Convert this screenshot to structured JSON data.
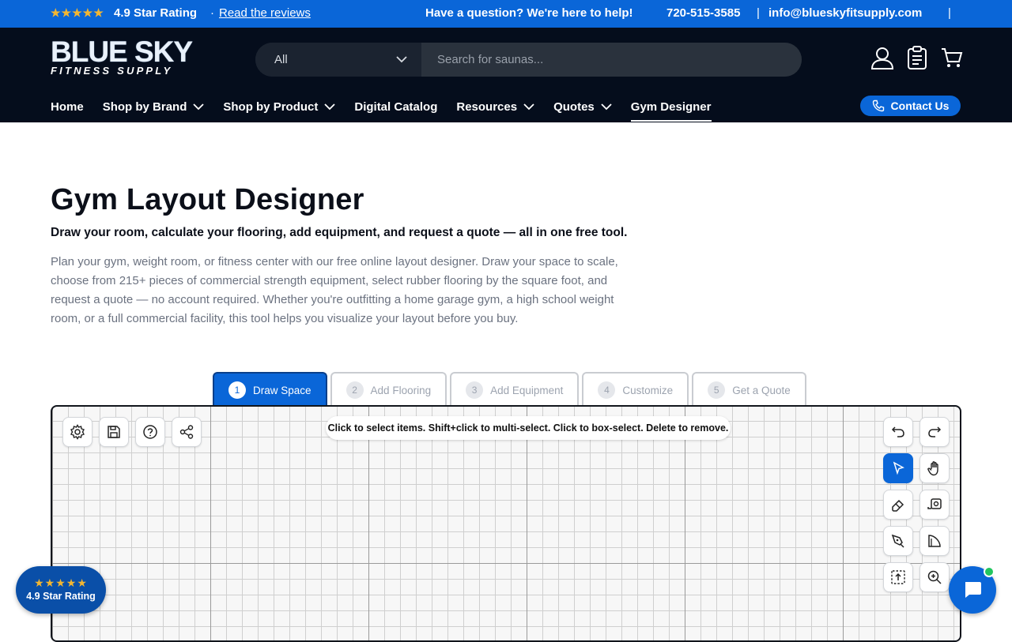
{
  "announcement": {
    "stars": "★★★★★",
    "rating": "4.9 Star Rating",
    "separator": "·",
    "reviews_link": "Read the reviews",
    "question": "Have a question? We're here to help!",
    "phone": "720-515-3585",
    "divider": "|",
    "email": "info@blueskyfitsupply.com"
  },
  "header": {
    "logo_line1": "BLUE SKY",
    "logo_line2": "FITNESS SUPPLY",
    "search": {
      "category": "All",
      "placeholder": "Search for saunas..."
    },
    "icons": [
      "account-icon",
      "clipboard-icon",
      "cart-icon"
    ]
  },
  "nav": {
    "items": [
      {
        "label": "Home",
        "dropdown": false
      },
      {
        "label": "Shop by Brand",
        "dropdown": true
      },
      {
        "label": "Shop by Product",
        "dropdown": true
      },
      {
        "label": "Digital Catalog",
        "dropdown": false
      },
      {
        "label": "Resources",
        "dropdown": true
      },
      {
        "label": "Quotes",
        "dropdown": true
      },
      {
        "label": "Gym Designer",
        "dropdown": false,
        "active": true
      }
    ],
    "contact_label": "Contact Us"
  },
  "main": {
    "title": "Gym Layout Designer",
    "subtitle": "Draw your room, calculate your flooring, add equipment, and request a quote — all in one free tool.",
    "description": "Plan your gym, weight room, or fitness center with our free online layout designer. Draw your space to scale, choose from 215+ pieces of commercial strength equipment, select rubber flooring by the square foot, and request a quote — no account required. Whether you're outfitting a home garage gym, a high school weight room, or a full commercial facility, this tool helps you visualize your layout before you buy."
  },
  "designer": {
    "steps": [
      {
        "num": "1",
        "label": "Draw Space",
        "active": true
      },
      {
        "num": "2",
        "label": "Add Flooring"
      },
      {
        "num": "3",
        "label": "Add Equipment"
      },
      {
        "num": "4",
        "label": "Customize"
      },
      {
        "num": "5",
        "label": "Get a Quote"
      }
    ],
    "hint": "Click to select items. Shift+click to multi-select. Click to box-select. Delete to remove.",
    "left_tools": [
      "settings-icon",
      "save-icon",
      "help-icon",
      "share-icon"
    ],
    "right_tools": [
      "undo-icon",
      "redo-icon",
      "select-icon",
      "pan-icon",
      "eraser-icon",
      "tape-measure-icon",
      "pen-icon",
      "wall-corner-icon",
      "fit-view-icon",
      "zoom-in-icon"
    ],
    "selected_tool": "select-icon"
  },
  "floating": {
    "badge_stars": "★★★★★",
    "badge_text": "4.9 Star Rating",
    "chat_icon": "chat-icon"
  },
  "colors": {
    "brand_blue": "#0a66d8",
    "header_dark": "#050d1c",
    "star": "#f2b632"
  }
}
